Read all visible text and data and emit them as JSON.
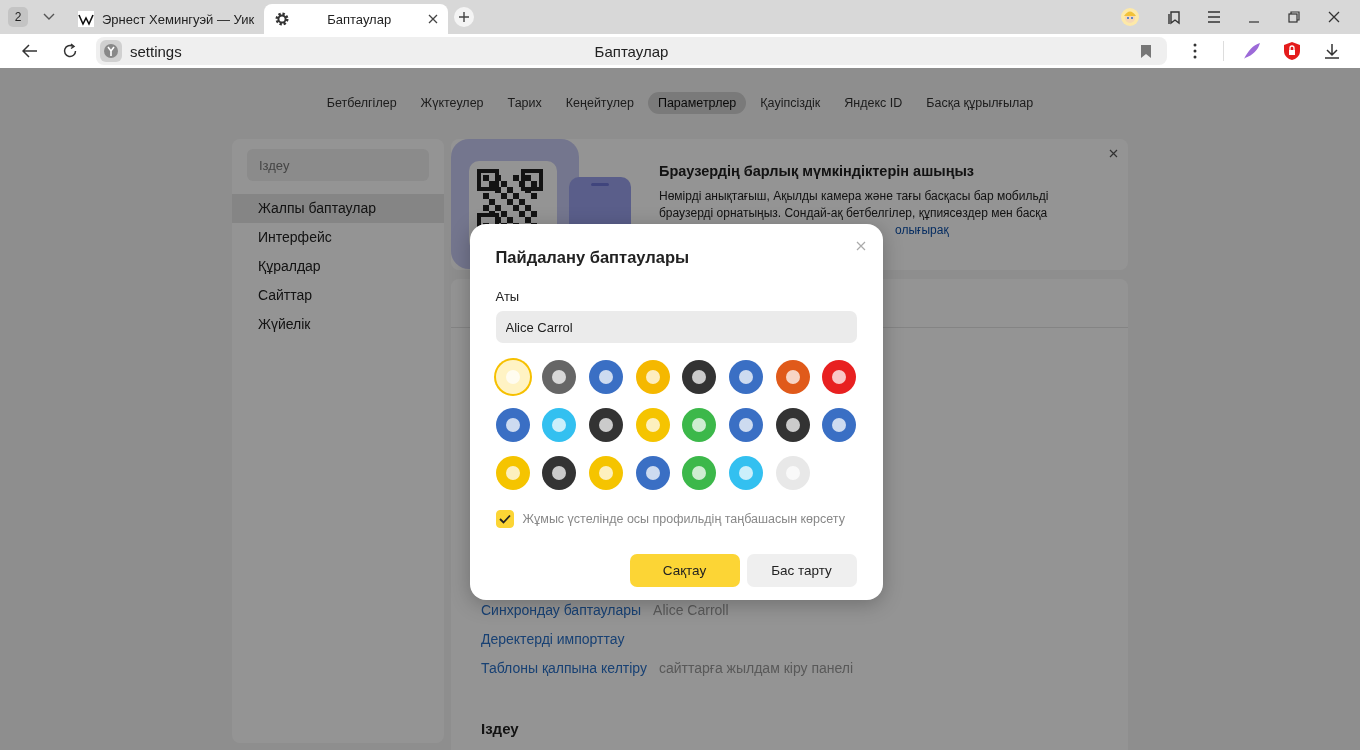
{
  "browser": {
    "tab_count": "2",
    "tabs": [
      {
        "title": "Эрнест Хемингуэй — Уик",
        "selected": false,
        "kind": "wiki"
      },
      {
        "title": "Баптаулар",
        "selected": true,
        "kind": "settings"
      }
    ],
    "address": "settings",
    "page_title": "Баптаулар"
  },
  "settings_nav": [
    {
      "label": "Бетбелгілер",
      "selected": false
    },
    {
      "label": "Жүктеулер",
      "selected": false
    },
    {
      "label": "Тарих",
      "selected": false
    },
    {
      "label": "Кеңейтулер",
      "selected": false
    },
    {
      "label": "Параметрлер",
      "selected": true
    },
    {
      "label": "Қауіпсіздік",
      "selected": false
    },
    {
      "label": "Яндекс ID",
      "selected": false
    },
    {
      "label": "Басқа құрылғылар",
      "selected": false
    }
  ],
  "sidebar": {
    "search": {
      "placeholder": "Іздеу"
    },
    "items": [
      {
        "label": "Жалпы баптаулар",
        "selected": true
      },
      {
        "label": "Интерфейс",
        "selected": false
      },
      {
        "label": "Құралдар",
        "selected": false
      },
      {
        "label": "Сайттар",
        "selected": false
      },
      {
        "label": "Жүйелік",
        "selected": false
      }
    ]
  },
  "promo": {
    "title": "Браузердің барлық мүмкіндіктерін ашыңыз",
    "text": "Нөмірді анықтағыш, Ақылды камера және тағы басқасы бар мобильді браузерді орнатыңыз. Сондай-ақ бетбелгілер, құпиясөздер мен басқа",
    "link": "олығырақ"
  },
  "general": {
    "rows": [
      {
        "link": "Синхрондау баптаулары",
        "note": "Alice Carroll"
      },
      {
        "link": "Деректерді импорттау"
      },
      {
        "link": "Таблоны қалпына келтіру",
        "note": "сайттарға жылдам кіру панелі"
      }
    ],
    "next_heading": "Іздеу"
  },
  "dialog": {
    "title": "Пайдалану баптаулары",
    "name_label": "Аты",
    "name_value": "Alice Carrol",
    "avatars": [
      {
        "color": "#fff3c4",
        "selected": true
      },
      {
        "color": "#666666",
        "selected": false
      },
      {
        "color": "#3a6fc4",
        "selected": false
      },
      {
        "color": "#f5b800",
        "selected": false
      },
      {
        "color": "#333333",
        "selected": false
      },
      {
        "color": "#3a6fc4",
        "selected": false
      },
      {
        "color": "#e05a1a",
        "selected": false
      },
      {
        "color": "#e82020",
        "selected": false
      },
      {
        "color": "#3a6fc4",
        "selected": false
      },
      {
        "color": "#33c0f0",
        "selected": false
      },
      {
        "color": "#333333",
        "selected": false
      },
      {
        "color": "#f5c400",
        "selected": false
      },
      {
        "color": "#3cb84a",
        "selected": false
      },
      {
        "color": "#3a6fc4",
        "selected": false
      },
      {
        "color": "#333333",
        "selected": false
      },
      {
        "color": "#3a6fc4",
        "selected": false
      },
      {
        "color": "#f5c400",
        "selected": false
      },
      {
        "color": "#333333",
        "selected": false
      },
      {
        "color": "#f5c400",
        "selected": false
      },
      {
        "color": "#3a6fc4",
        "selected": false
      },
      {
        "color": "#3cb84a",
        "selected": false
      },
      {
        "color": "#33c0f0",
        "selected": false
      },
      {
        "color": "#e8e8e8",
        "selected": false
      }
    ],
    "shortcut": {
      "label": "Жұмыс үстелінде осы профильдің таңбашасын көрсету",
      "checked": true
    },
    "buttons": [
      {
        "label": "Сақтау",
        "kind": "primary"
      },
      {
        "label": "Бас тарту",
        "kind": "secondary"
      }
    ]
  }
}
